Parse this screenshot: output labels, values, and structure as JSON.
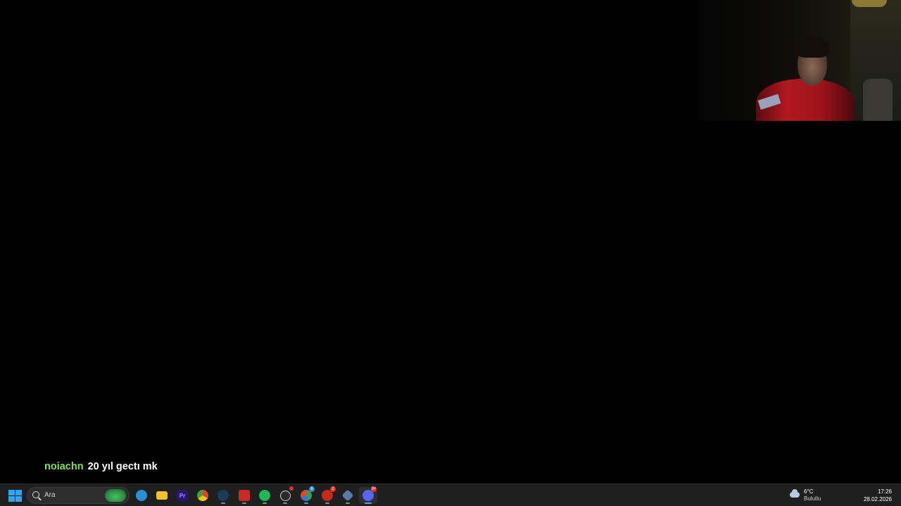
{
  "chat": {
    "username": "noiachn",
    "message": "20 yıl gectı mk",
    "username_color": "#7de35a"
  },
  "webcam": {
    "description_icon": "webcam-feed"
  },
  "taskbar": {
    "search_placeholder": "Ara",
    "apps": [
      {
        "name": "edge",
        "icon": "edge-icon",
        "color": "#2a8fd6"
      },
      {
        "name": "file-explorer",
        "icon": "folder-icon",
        "color": "#f2c12e"
      },
      {
        "name": "premiere-pro",
        "icon": "premiere-icon",
        "color": "#2a1670",
        "glyph": "Pr"
      },
      {
        "name": "chrome",
        "icon": "chrome-icon",
        "color": "#e0452c"
      },
      {
        "name": "steam",
        "icon": "steam-icon",
        "color": "#1d3a5a"
      },
      {
        "name": "news-app",
        "icon": "news-icon",
        "color": "#c82a2a"
      },
      {
        "name": "spotify",
        "icon": "spotify-icon",
        "color": "#1db954"
      },
      {
        "name": "app-circle",
        "icon": "circle-app-icon",
        "color": "#3a3a3a"
      },
      {
        "name": "chrome-profile",
        "icon": "chrome-icon",
        "color": "#3a9b4a",
        "badge": "6"
      },
      {
        "name": "app-red",
        "icon": "red-app-icon",
        "color": "#c62a1c",
        "badge": "2"
      },
      {
        "name": "app-settings",
        "icon": "gear-app-icon",
        "color": "#5a7aa8"
      },
      {
        "name": "discord",
        "icon": "discord-icon",
        "color": "#5865f2",
        "badge": "9+"
      }
    ],
    "weather": {
      "temperature": "6°C",
      "condition": "Bulutlu"
    },
    "clock": {
      "time": "17:26",
      "date": "28.02.2026"
    }
  }
}
